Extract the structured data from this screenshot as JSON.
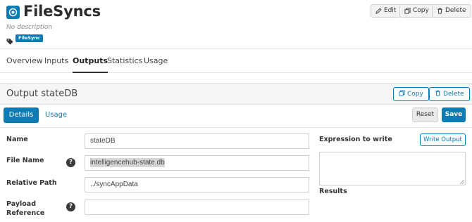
{
  "app": {
    "title": "FileSyncs",
    "description": "No description",
    "tag": "FileSync",
    "actions": {
      "edit": "Edit",
      "copy": "Copy",
      "delete": "Delete"
    }
  },
  "main_tabs": [
    {
      "label": "Overview",
      "active": false
    },
    {
      "label": "Inputs",
      "active": false
    },
    {
      "label": "Outputs",
      "active": true
    },
    {
      "label": "Statistics",
      "active": false
    },
    {
      "label": "Usage",
      "active": false
    }
  ],
  "output_panel": {
    "title": "Output stateDB",
    "copy": "Copy",
    "delete": "Delete"
  },
  "sub_tabs": [
    {
      "label": "Details",
      "active": true
    },
    {
      "label": "Usage",
      "active": false
    }
  ],
  "form_actions": {
    "reset": "Reset",
    "save": "Save"
  },
  "form": {
    "name": {
      "label": "Name",
      "value": "stateDB"
    },
    "file_name": {
      "label": "File Name",
      "value": "intelligencehub-state.db",
      "help": "?"
    },
    "relative_path": {
      "label": "Relative Path",
      "value": "../syncAppData"
    },
    "payload_reference": {
      "label_line1": "Payload",
      "label_line2": "Reference",
      "value": "",
      "help": "?"
    }
  },
  "expression": {
    "label": "Expression to write",
    "write_button": "Write Output",
    "value": "",
    "results_label": "Results"
  },
  "colors": {
    "accent": "#0b7bb3",
    "header_border": "#e2e2e2"
  },
  "icons": [
    "app-logo-icon",
    "tag-icon",
    "edit-icon",
    "copy-icon",
    "trash-icon",
    "help-icon"
  ]
}
